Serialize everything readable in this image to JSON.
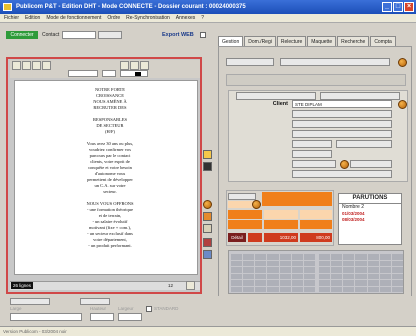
{
  "window": {
    "title": "Publicom P&T - Edition DHT - Mode CONNECTE - Dossier courant : 00024000375",
    "min": "_",
    "max": "□",
    "close": "×"
  },
  "menu": [
    "Fichier",
    "Edition",
    "Mode de fonctionnement",
    "Ordre",
    "Re-Synchronisation",
    "Annexes",
    "?"
  ],
  "toolbar": {
    "connect_label": "Connecter",
    "contact_label": "Contact",
    "export_web": "Export WEB"
  },
  "tabs": [
    {
      "label": "Gestion"
    },
    {
      "label": "Dom./Regi"
    },
    {
      "label": "Relecture"
    },
    {
      "label": "Maquette"
    },
    {
      "label": "Recherche"
    },
    {
      "label": "Compta"
    }
  ],
  "document": {
    "lines": [
      "NOTRE FORTE",
      "CROISSANCE",
      "NOUS AMÈNE À",
      "RECRUTER DES",
      "",
      "RESPONSABLES",
      "DE SECTEUR",
      "(H/F)",
      "",
      "Vous avez 30 ans ou plus,",
      "voudriez confirmer vos",
      "parcours par le contact",
      "clients, votre esprit de",
      "conquête et votre besoin",
      "d'autonome vous",
      "permettent de développer",
      "un C.A. sur votre",
      "secteur.",
      "",
      "NOUS VOUS OFFRONS",
      "- une formation théorique",
      "et de terrain,",
      "- un salaire évolutif",
      "motivant (fixe + com.),",
      "- un secteur exclusif dans",
      "votre département,",
      "- un produit performant."
    ],
    "lines_badge": "26 lignes",
    "page_num": "12"
  },
  "client": {
    "label": "Client",
    "value": "STE DIPLAM"
  },
  "price": {
    "detail_label": "Détail",
    "amount1": "1032,00",
    "amount2": "800,00"
  },
  "parutions": {
    "title": "PARUTIONS",
    "count_label": "Nombre",
    "count": "2",
    "dates": [
      "01/03/2004",
      "08/03/2004"
    ]
  },
  "bottom": {
    "field1_label": "Large",
    "field2_label": "Hauteur",
    "field3_label": "Largeur",
    "checkbox_label": "STANDARD"
  },
  "statusbar": "Version Publicom - 03/2004 noir"
}
